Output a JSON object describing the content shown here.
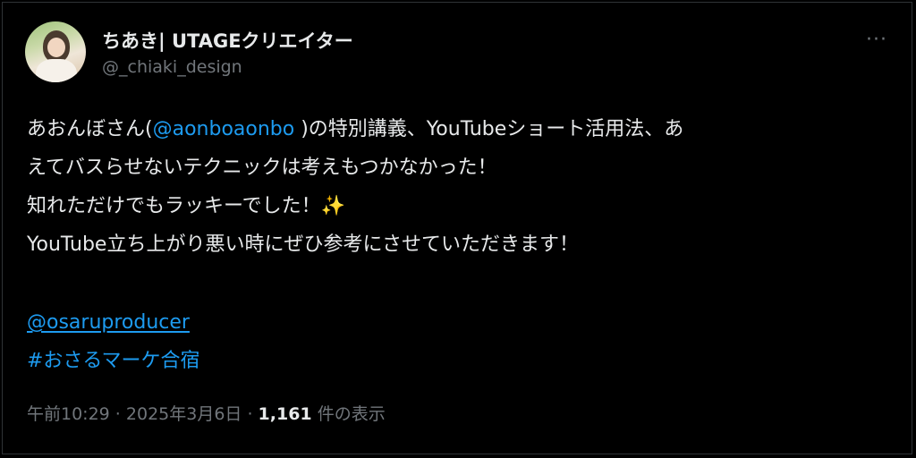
{
  "author": {
    "display_name": "ちあき| UTAGEクリエイター",
    "handle": "@_chiaki_design"
  },
  "tweet": {
    "line1_a": "あおんぼさん(",
    "mention1": "@aonboaonbo",
    "line1_b": " )の特別講義、YouTubeショート活用法、あ",
    "line2": "えてバスらせないテクニックは考えもつかなかった！",
    "line3": "知れただけでもラッキーでした！✨",
    "line4": "YouTube立ち上がり悪い時にぜひ参考にさせていただきます！",
    "mention2": "@osaruproducer",
    "hashtag": "#おさるマーケ合宿"
  },
  "meta": {
    "time": "午前10:29",
    "separator1": " · ",
    "date": "2025年3月6日",
    "separator2": " · ",
    "views_count": "1,161",
    "views_label": " 件の表示"
  },
  "icons": {
    "more": "more-horizontal-icon"
  },
  "colors": {
    "background": "#000000",
    "text": "#e7e9ea",
    "secondary": "#71767b",
    "link": "#1d9bf0"
  }
}
